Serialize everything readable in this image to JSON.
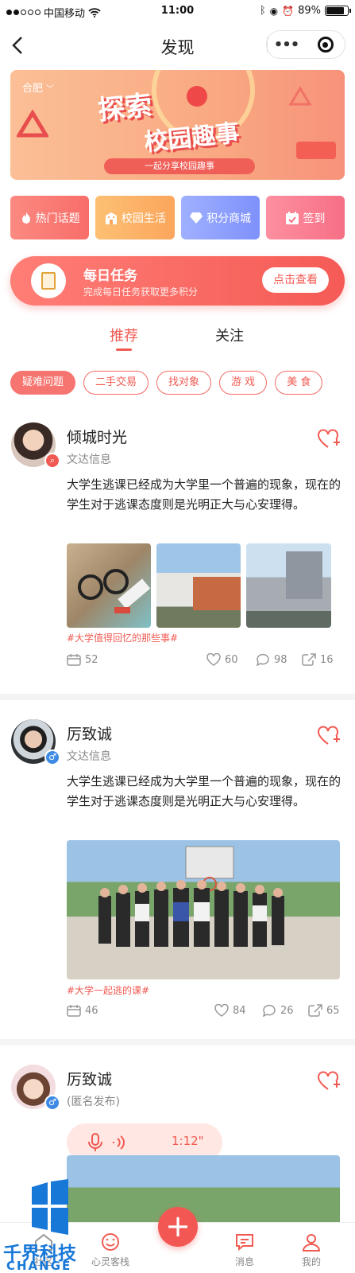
{
  "status_bar": {
    "carrier": "中国移动",
    "time": "11:00",
    "battery": "89%"
  },
  "nav": {
    "title": "发现",
    "back_glyph": "<",
    "more_glyph": "•••"
  },
  "banner": {
    "city": "合肥",
    "headline_1": "探索",
    "headline_2": "校园趣事",
    "caption": "一起分享校园趣事"
  },
  "shortcuts": [
    {
      "label": "热门话题",
      "icon": "fire-icon",
      "color": "#f9776f"
    },
    {
      "label": "校园生活",
      "icon": "building-icon",
      "color": "#fbb163"
    },
    {
      "label": "积分商城",
      "icon": "diamond-icon",
      "color": "#8d9ffd"
    },
    {
      "label": "签到",
      "icon": "calendar-icon",
      "color": "#f97c8f"
    }
  ],
  "daily_task": {
    "title": "每日任务",
    "subtitle": "完成每日任务获取更多积分",
    "button": "点击查看"
  },
  "tabs": [
    {
      "label": "推荐",
      "active": true
    },
    {
      "label": "关注",
      "active": false
    }
  ],
  "chips": [
    {
      "label": "疑难问题",
      "active": true
    },
    {
      "label": "二手交易",
      "active": false
    },
    {
      "label": "找对象",
      "active": false
    },
    {
      "label": "游 戏",
      "active": false
    },
    {
      "label": "美 食",
      "active": false
    }
  ],
  "posts": [
    {
      "name": "倾城时光",
      "sub": "文达信息",
      "body": "大学生逃课已经成为大学里一个普遍的现象，现在的学生对于逃课态度则是光明正大与心安理得。",
      "tag": "#大学值得回忆的那些事#",
      "views": "52",
      "likes": "60",
      "comments": "98",
      "shares": "16",
      "badge_glyph": "⌕"
    },
    {
      "name": "厉致诚",
      "sub": "文达信息",
      "body": "大学生逃课已经成为大学里一个普遍的现象，现在的学生对于逃课态度则是光明正大与心安理得。",
      "tag": "#大学一起逃的课#",
      "views": "46",
      "likes": "84",
      "comments": "26",
      "shares": "65",
      "badge_glyph": "♂"
    },
    {
      "name": "厉致诚",
      "sub": "(匿名发布)",
      "voice_duration": "1:12\"",
      "badge_glyph": "♂"
    }
  ],
  "tabbar": [
    {
      "label": "社区",
      "icon": "home-icon"
    },
    {
      "label": "心灵客栈",
      "icon": "smile-icon"
    },
    {
      "label": "",
      "icon": "plus-icon"
    },
    {
      "label": "消息",
      "icon": "message-icon"
    },
    {
      "label": "我的",
      "icon": "user-icon"
    }
  ],
  "plus_glyph": "+",
  "watermark": {
    "cn": "千界科技",
    "en": "CHANGE"
  },
  "colors": {
    "accent": "#f15a52",
    "accent_light": "#ffe7e3",
    "blue": "#3d8be5"
  }
}
